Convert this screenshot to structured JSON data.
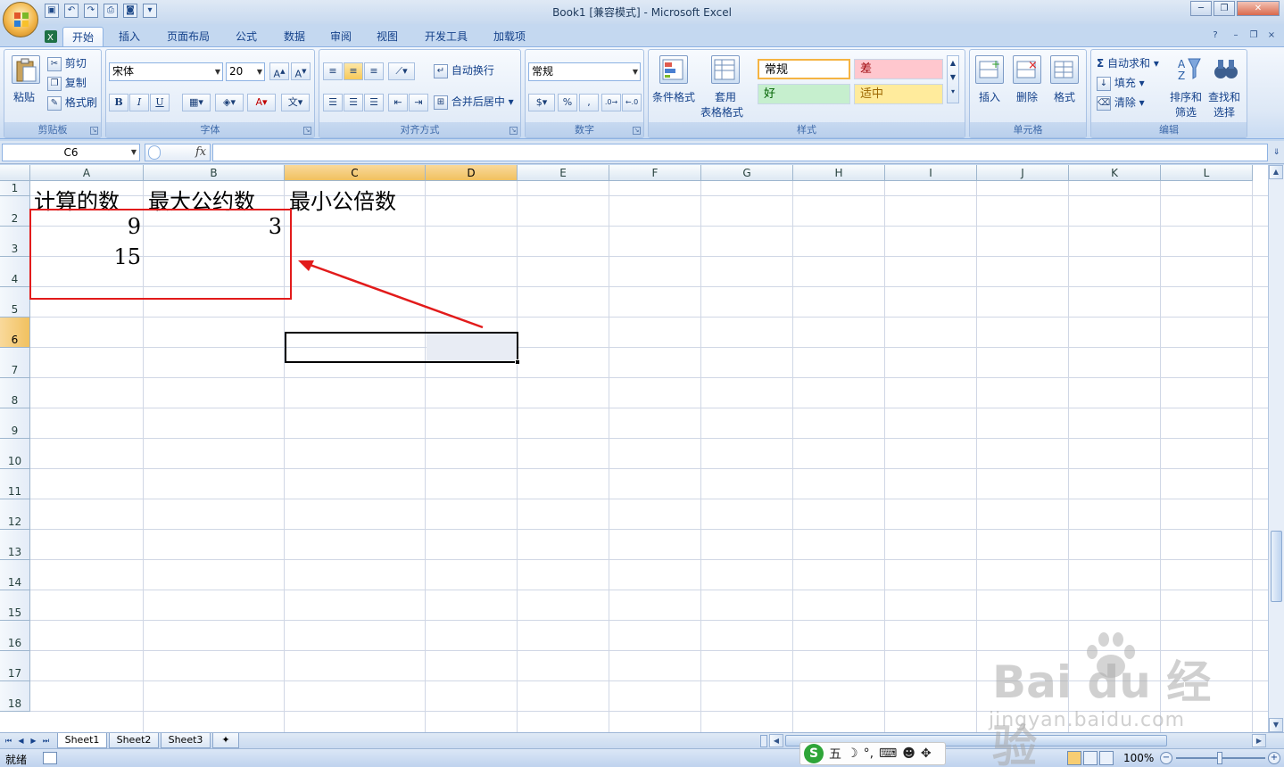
{
  "title": {
    "text": "Book1  [兼容模式] - Microsoft Excel",
    "minimize": "─",
    "restore": "❐",
    "close": "✕"
  },
  "ribbon_tabs": [
    {
      "label": "开始"
    },
    {
      "label": "插入"
    },
    {
      "label": "页面布局"
    },
    {
      "label": "公式"
    },
    {
      "label": "数据"
    },
    {
      "label": "审阅"
    },
    {
      "label": "视图"
    },
    {
      "label": "开发工具"
    },
    {
      "label": "加载项"
    }
  ],
  "clipboard": {
    "paste": "粘贴",
    "cut": "剪切",
    "copy": "复制",
    "format_painter": "格式刷",
    "label": "剪贴板"
  },
  "font": {
    "name": "宋体",
    "size": "20",
    "label": "字体",
    "bold": "B",
    "italic": "I",
    "underline": "U"
  },
  "alignment": {
    "wrap": "自动换行",
    "merge": "合并后居中",
    "label": "对齐方式"
  },
  "number": {
    "format": "常规",
    "label": "数字",
    "percent": "%",
    "comma": ","
  },
  "styles": {
    "conditional": "条件格式",
    "table_format_1": "套用",
    "table_format_2": "表格格式",
    "normal": "常规",
    "bad": "差",
    "good": "好",
    "neutral": "适中",
    "label": "样式"
  },
  "cells": {
    "insert": "插入",
    "delete": "删除",
    "format": "格式",
    "label": "单元格"
  },
  "editing": {
    "autosum": "自动求和",
    "fill": "填充",
    "clear": "清除",
    "sort_1": "排序和",
    "sort_2": "筛选",
    "find_1": "查找和",
    "find_2": "选择",
    "label": "编辑"
  },
  "formula_bar": {
    "name_box": "C6",
    "fx": "fx",
    "content": ""
  },
  "columns": [
    "A",
    "B",
    "C",
    "D",
    "E",
    "F",
    "G",
    "H",
    "I",
    "J",
    "K",
    "L"
  ],
  "rows": [
    "1",
    "2",
    "3",
    "4",
    "5",
    "6",
    "7",
    "8",
    "9",
    "10",
    "11",
    "12",
    "13",
    "14",
    "15",
    "16",
    "17",
    "18"
  ],
  "cell_values": {
    "A1": "计算的数",
    "B1": "最大公约数",
    "C1": "最小公倍数",
    "A2": "9",
    "B2": "3",
    "A3": "15"
  },
  "selected_cell": "C6",
  "sheets": [
    "Sheet1",
    "Sheet2",
    "Sheet3"
  ],
  "status": {
    "ready": "就绪",
    "zoom": "100%"
  },
  "ime": {
    "logo": "S",
    "mode": "五"
  },
  "watermark": {
    "line1": "Bai du 经验",
    "line2": "jingyan.baidu.com"
  },
  "colors": {
    "annotation": "#e21b1b",
    "bad_style": "#ffc7ce",
    "good_style": "#c6efce",
    "neutral_style": "#ffeb9c"
  }
}
